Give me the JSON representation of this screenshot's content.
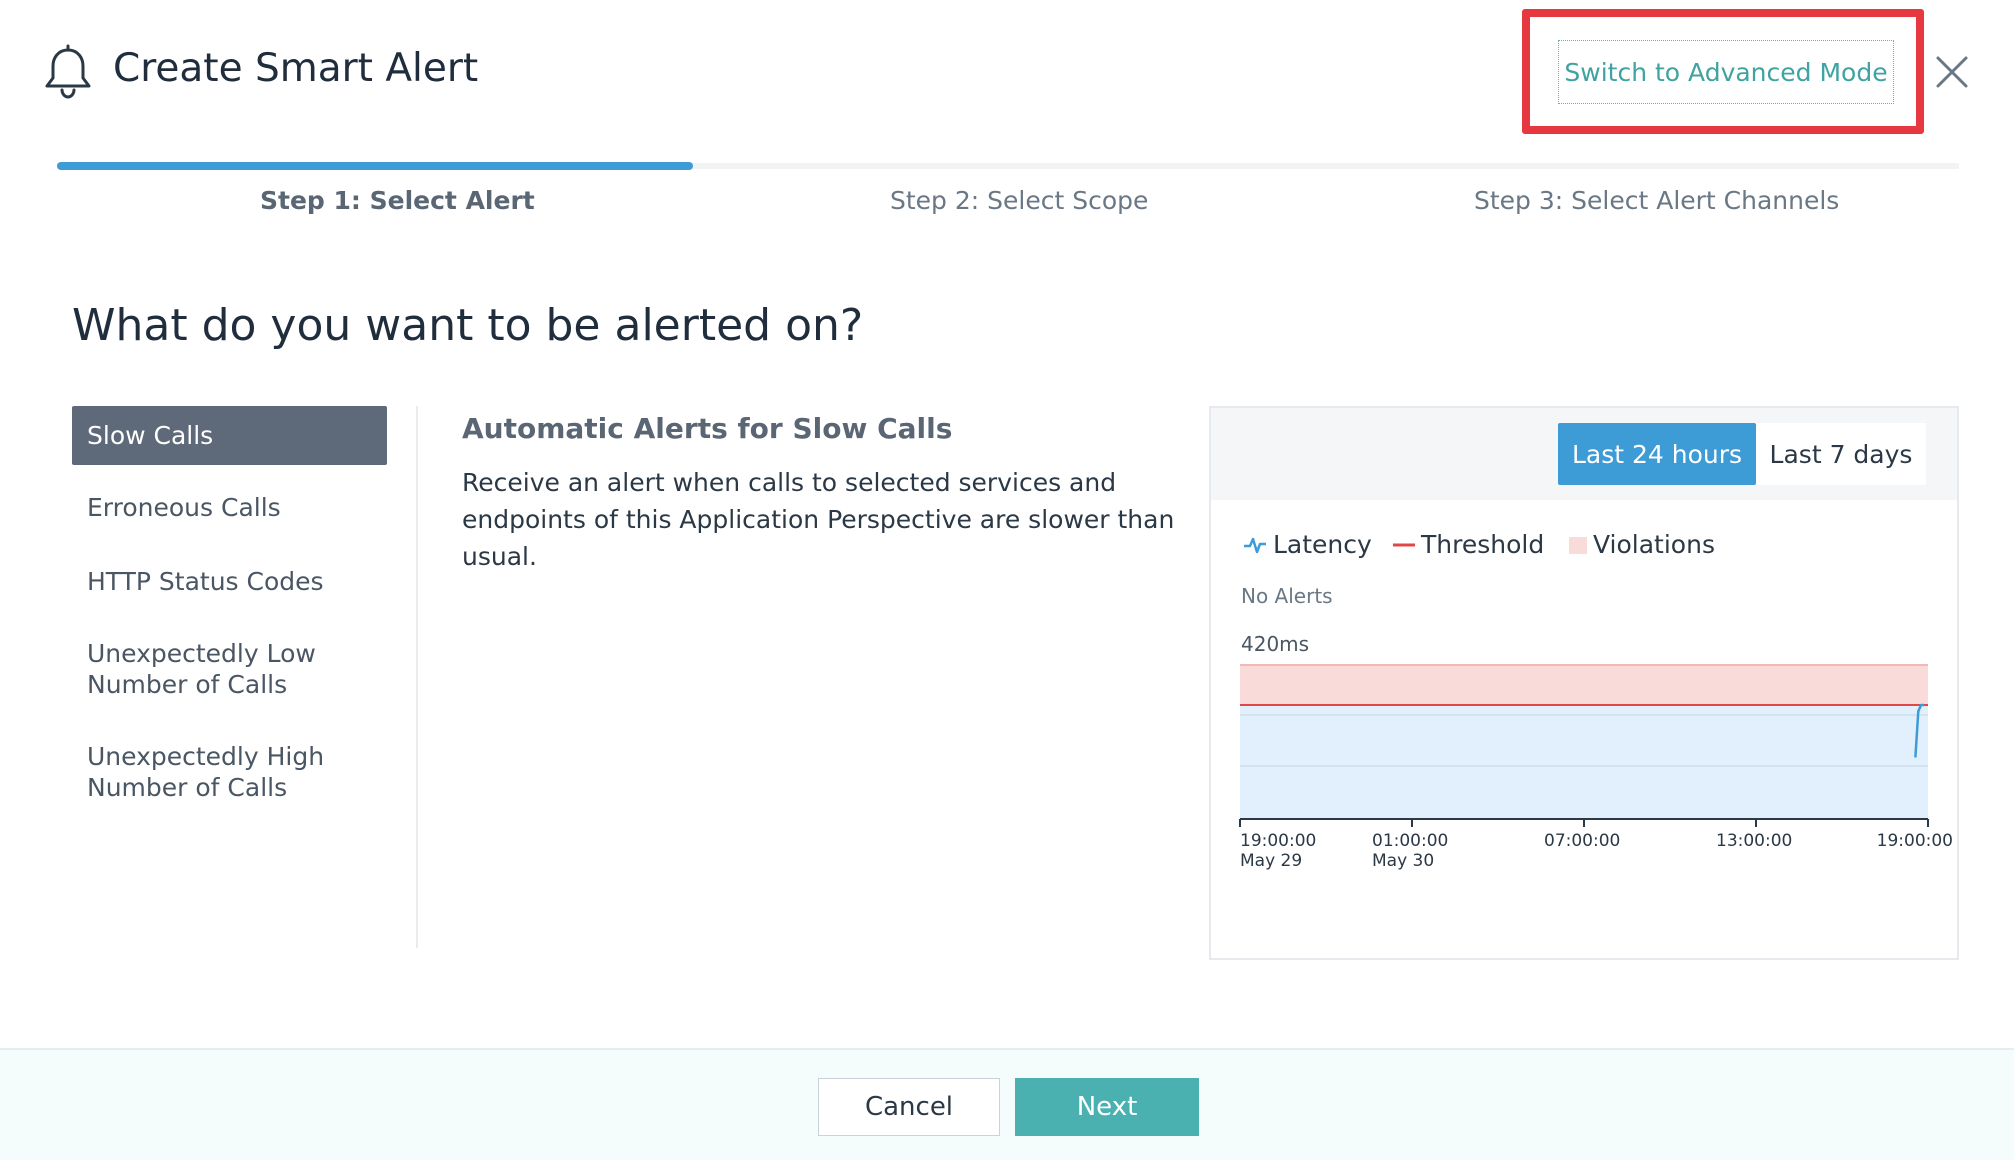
{
  "dialog": {
    "title": "Create Smart Alert",
    "advanced_mode_label": "Switch to Advanced Mode",
    "close_icon": "close-icon",
    "bell_icon": "bell-icon"
  },
  "stepper": {
    "progress_fraction": 0.333,
    "steps": [
      {
        "label": "Step 1: Select Alert",
        "active": true
      },
      {
        "label": "Step 2: Select Scope",
        "active": false
      },
      {
        "label": "Step 3: Select Alert Channels",
        "active": false
      }
    ]
  },
  "main": {
    "question": "What do you want to be alerted on?",
    "menu": [
      {
        "label": "Slow Calls",
        "selected": true
      },
      {
        "label": "Erroneous Calls",
        "selected": false
      },
      {
        "label": "HTTP Status Codes",
        "selected": false
      },
      {
        "label": "Unexpectedly Low Number of Calls",
        "selected": false
      },
      {
        "label": "Unexpectedly High Number of Calls",
        "selected": false
      }
    ],
    "description_title": "Automatic Alerts for Slow Calls",
    "description_text": "Receive an alert when calls to selected services and endpoints of this Application Perspective are slower than usual."
  },
  "chart_panel": {
    "ranges": [
      {
        "label": "Last 24 hours",
        "selected": true
      },
      {
        "label": "Last 7 days",
        "selected": false
      }
    ],
    "legend": {
      "latency": "Latency",
      "threshold": "Threshold",
      "violations": "Violations"
    },
    "no_alerts": "No Alerts",
    "y_max_label": "420ms",
    "colors": {
      "latency": "#3d9bd6",
      "threshold": "#e04848",
      "violations": "#f9dcda",
      "area": "#e1f0fc"
    }
  },
  "chart_data": {
    "type": "line",
    "x_ticks": [
      {
        "time": "19:00:00",
        "date": "May 29"
      },
      {
        "time": "01:00:00",
        "date": "May 30"
      },
      {
        "time": "07:00:00",
        "date": ""
      },
      {
        "time": "13:00:00",
        "date": ""
      },
      {
        "time": "19:00:00",
        "date": ""
      }
    ],
    "y_max": "420ms",
    "threshold_fraction": 0.8,
    "violation_band_top_fraction": 1.0,
    "series": [
      {
        "name": "Latency",
        "points": [
          {
            "x_hours": 23.7,
            "y_fraction": 0.4
          },
          {
            "x_hours": 23.8,
            "y_fraction": 0.7
          },
          {
            "x_hours": 23.9,
            "y_fraction": 0.74
          },
          {
            "x_hours": 24.0,
            "y_fraction": 0.74
          }
        ]
      }
    ]
  },
  "footer": {
    "cancel_label": "Cancel",
    "next_label": "Next"
  }
}
